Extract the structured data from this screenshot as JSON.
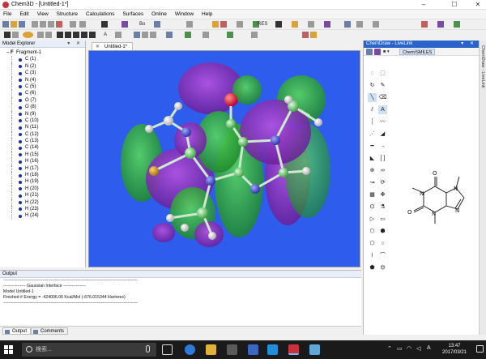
{
  "window": {
    "title": "Chem3D - [Untitled-1*]",
    "min": "–",
    "max": "☐",
    "close": "✕"
  },
  "menu": [
    "File",
    "Edit",
    "View",
    "Structure",
    "Calculations",
    "Surfaces",
    "Online",
    "Window",
    "Help"
  ],
  "toolbar": {
    "font_value": "Bo",
    "res_label": "RES"
  },
  "explorer": {
    "title": "Model Explorer",
    "controls": "▾ ✕",
    "root": "Fragment-1",
    "atoms": [
      "C (1)",
      "N (2)",
      "C (3)",
      "N (4)",
      "C (5)",
      "C (6)",
      "O (7)",
      "O (8)",
      "N (9)",
      "C (10)",
      "N (11)",
      "C (12)",
      "C (13)",
      "C (14)",
      "H (15)",
      "H (16)",
      "H (17)",
      "H (18)",
      "H (19)",
      "H (20)",
      "H (21)",
      "H (22)",
      "H (23)",
      "H (24)"
    ]
  },
  "document": {
    "tab_label": "Untitled-1*"
  },
  "output": {
    "title": "Output",
    "lines": [
      "------------------------------------------------------------------------------------------------",
      "",
      "---------------- Gaussian Interface ----------------",
      "Model Untitled-1",
      "",
      "Finished # Energy = -424006.06 Kcal/Mol (-676.015344 Hartrees)",
      "",
      "------------------------------------------------------------------------------------------------"
    ],
    "tabs": [
      "Output",
      "Comments"
    ]
  },
  "chemdraw": {
    "title": "ChemDraw - LiveLink",
    "controls": "▾ ✕",
    "tab_prefix": "■ ▾",
    "tab": "Chem/SMILES",
    "side_label": "ChemDraw - LiveLink",
    "structure_atoms": {
      "o_top": "O",
      "o_left": "O",
      "n1": "N",
      "n3": "N",
      "n7": "N",
      "n9": "N"
    }
  },
  "taskbar": {
    "search_placeholder": "検索...",
    "time": "13:47",
    "date": "2017/03/21",
    "lang": "A"
  },
  "colors": {
    "viewport_bg": "#2e5cec",
    "lobe_purple": "#8a2bb8",
    "lobe_green": "#2ea83a",
    "taskbar": "#1a1a1a"
  }
}
